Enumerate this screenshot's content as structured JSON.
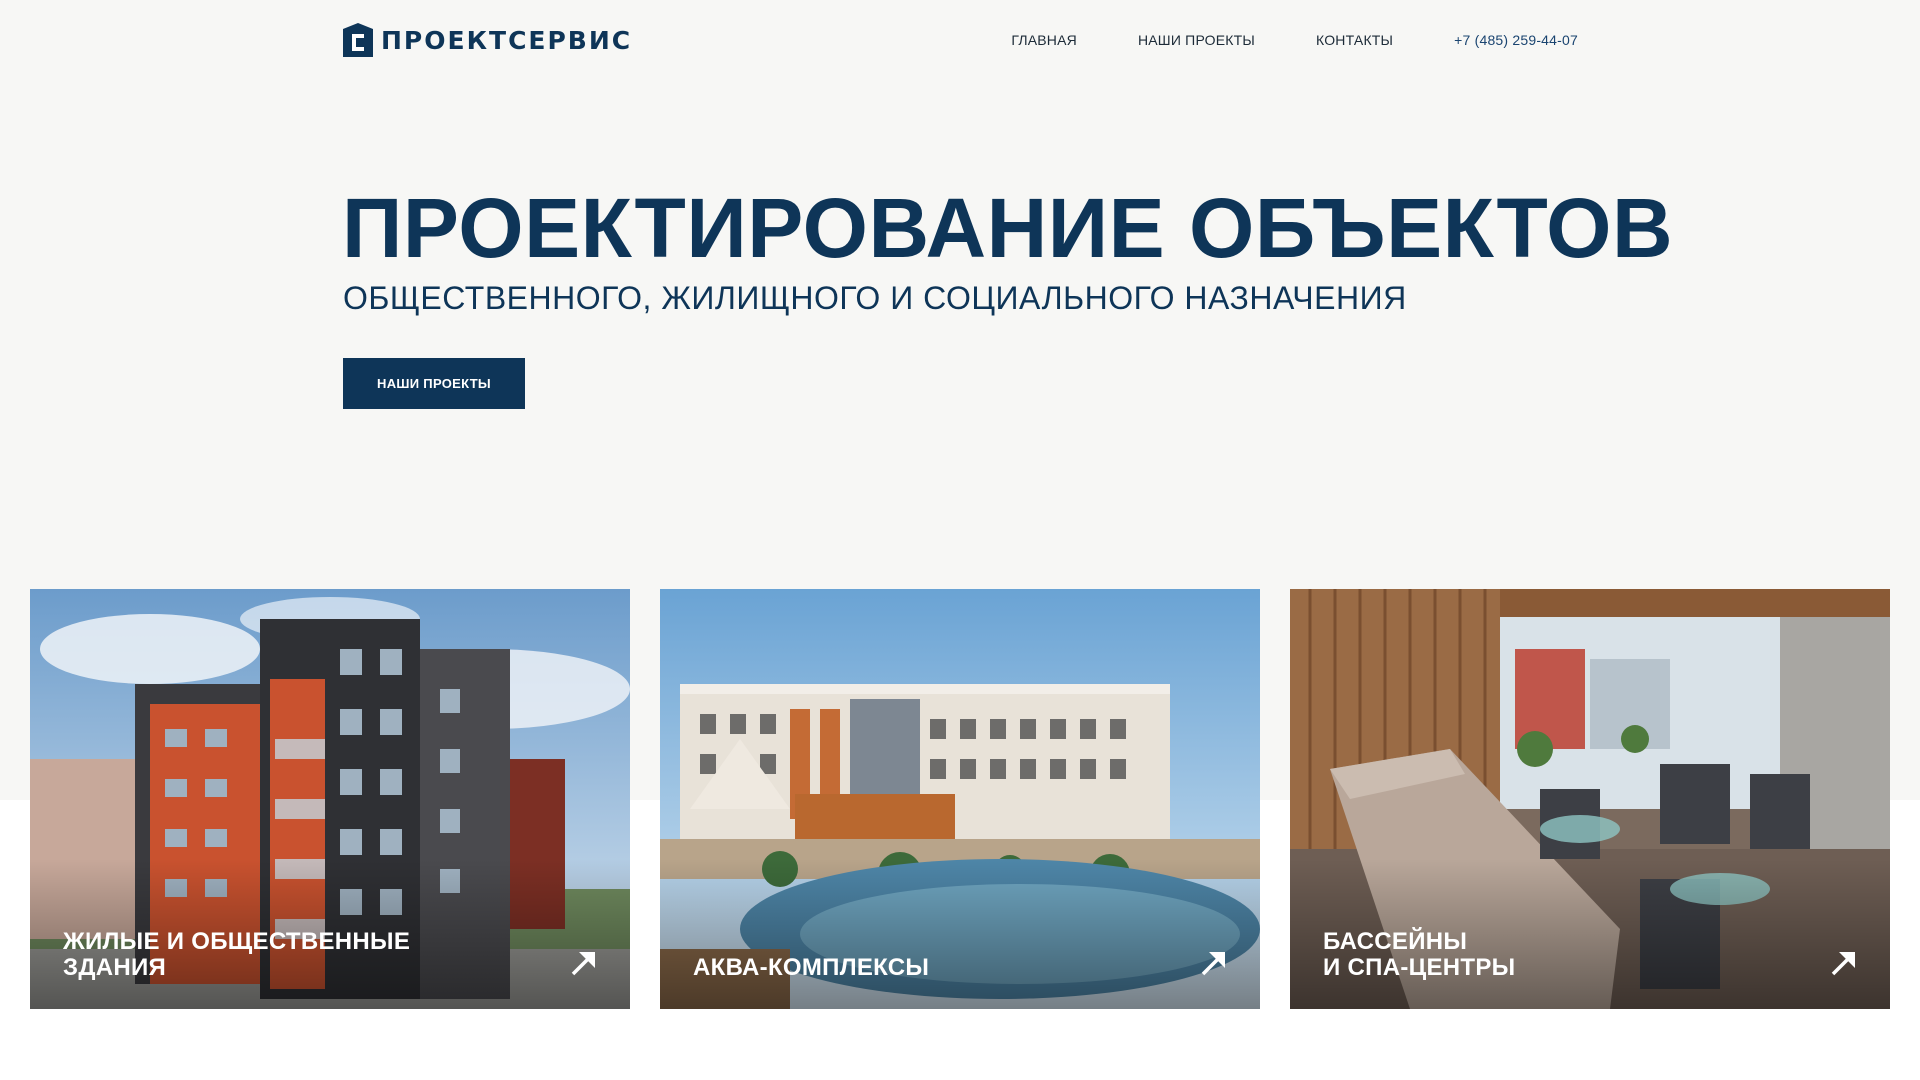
{
  "header": {
    "logo_text": "ПРОЕКТСЕРВИС",
    "nav": [
      {
        "label": "ГЛАВНАЯ"
      },
      {
        "label": "НАШИ ПРОЕКТЫ"
      },
      {
        "label": "КОНТАКТЫ"
      }
    ],
    "phone": "+7 (485) 259-44-07"
  },
  "hero": {
    "title": "ПРОЕКТИРОВАНИЕ ОБЪЕКТОВ",
    "subtitle": "ОБЩЕСТВЕННОГО, ЖИЛИЩНОГО И СОЦИАЛЬНОГО НАЗНАЧЕНИЯ",
    "button_label": "НАШИ ПРОЕКТЫ"
  },
  "cards": [
    {
      "line1": "ЖИЛЫЕ И ОБЩЕСТВЕННЫЕ",
      "line2": "ЗДАНИЯ",
      "icon": "arrow-up-right-icon"
    },
    {
      "line1": "АКВА-КОМПЛЕКСЫ",
      "line2": "",
      "icon": "arrow-up-right-icon"
    },
    {
      "line1": "БАССЕЙНЫ",
      "line2": "И СПА-ЦЕНТРЫ",
      "icon": "arrow-up-right-icon"
    }
  ],
  "colors": {
    "brand": "#0e3558",
    "background": "#f7f7f5",
    "button_text": "#ffffff"
  }
}
